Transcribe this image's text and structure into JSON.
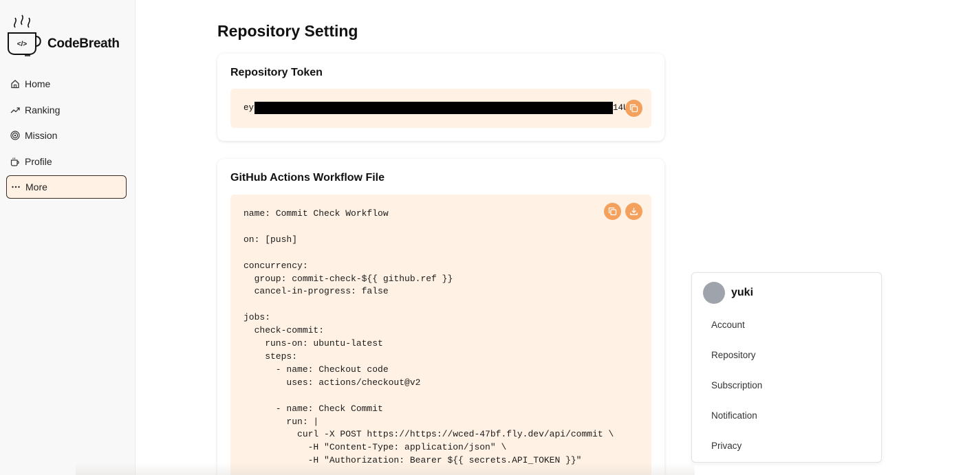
{
  "app": {
    "name": "CodeBreath",
    "logo_code_glyph": "</>"
  },
  "sidebar": {
    "items": [
      {
        "label": "Home",
        "icon": "home-icon"
      },
      {
        "label": "Ranking",
        "icon": "trending-up-icon"
      },
      {
        "label": "Mission",
        "icon": "target-icon"
      },
      {
        "label": "Profile",
        "icon": "coffee-cup-icon"
      },
      {
        "label": "More",
        "icon": "more-horizontal-icon",
        "active": true
      }
    ]
  },
  "page": {
    "title": "Repository Setting"
  },
  "token_card": {
    "title": "Repository Token",
    "token_visible_start": "ey",
    "token_visible_end": "14U",
    "copy_icon": "copy-icon"
  },
  "workflow_card": {
    "title": "GitHub Actions Workflow File",
    "copy_icon": "copy-icon",
    "download_icon": "download-icon",
    "code": "name: Commit Check Workflow\n\non: [push]\n\nconcurrency:\n  group: commit-check-${{ github.ref }}\n  cancel-in-progress: false\n\njobs:\n  check-commit:\n    runs-on: ubuntu-latest\n    steps:\n      - name: Checkout code\n        uses: actions/checkout@v2\n\n      - name: Check Commit\n        run: |\n          curl -X POST https://https://wced-47bf.fly.dev/api/commit \\\n            -H \"Content-Type: application/json\" \\\n            -H \"Authorization: Bearer ${{ secrets.API_TOKEN }}\""
  },
  "user_menu": {
    "username": "yuki",
    "items": [
      "Account",
      "Repository",
      "Subscription",
      "Notification",
      "Privacy"
    ]
  },
  "colors": {
    "accent": "#f4a15d",
    "code_bg": "#fff1e3",
    "active_border": "#3a2a22",
    "avatar": "#9fa3ab"
  }
}
